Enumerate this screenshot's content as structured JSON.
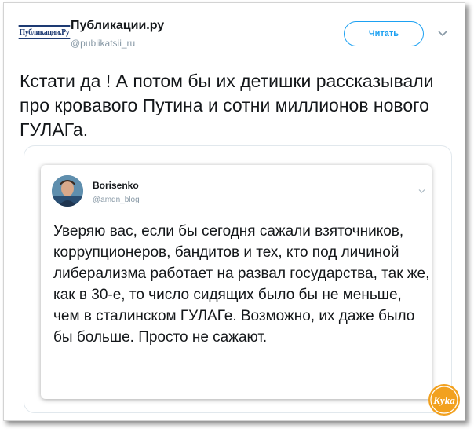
{
  "tweet": {
    "author_name": "Публикации.ру",
    "author_handle": "@publikatsii_ru",
    "avatar_logo_text": "Публикации.Ру",
    "follow_label": "Читать",
    "text": "Кстати да ! А потом бы их детишки рассказывали про кровавого Путина и сотни миллионов нового ГУЛАГа."
  },
  "quoted_tweet": {
    "author_name": "Borisenko",
    "author_handle": "@amdn_blog",
    "text": "Уверяю вас, если бы сегодня сажали взяточников, коррупционеров, бандитов и тех, кто под личиной либерализма работает на развал государства, так же, как в 30-е, то число сидящих было бы не меньше, чем в сталинском ГУЛАГе. Возможно, их даже было бы больше. Просто не сажают."
  },
  "watermark": {
    "text": "Kyka"
  },
  "colors": {
    "accent": "#1da1f2",
    "text": "#14171a",
    "muted": "#8899a6",
    "watermark": "#f2a11f"
  }
}
